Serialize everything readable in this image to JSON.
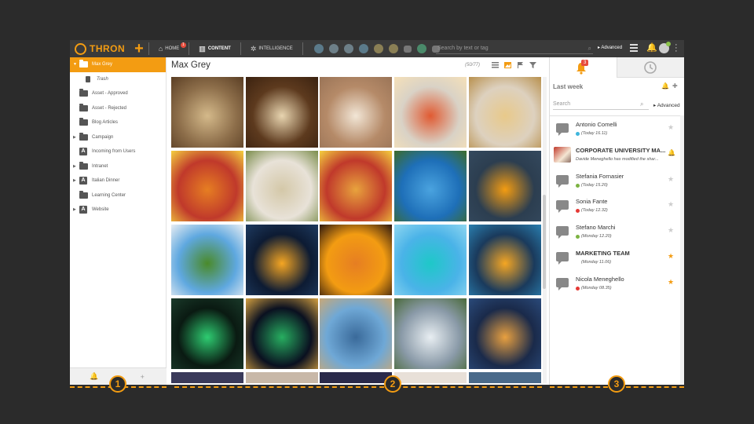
{
  "app": {
    "brand": "THRON",
    "nav": [
      {
        "label": "HOME",
        "icon": "home-icon",
        "badge": "1"
      },
      {
        "label": "CONTENT",
        "icon": "book-icon"
      },
      {
        "label": "INTELLIGENCE",
        "icon": "network-icon"
      }
    ],
    "search_placeholder": "Search by text or tag",
    "advanced_label": "Advanced",
    "accent_color": "#f39c12"
  },
  "sidebar": {
    "folders": [
      {
        "label": "Max Grey",
        "type": "folder",
        "selected": true,
        "caret": "down"
      },
      {
        "label": "Trash",
        "type": "trash",
        "indent": true
      },
      {
        "label": "Asset - Approved",
        "type": "folder"
      },
      {
        "label": "Asset - Rejected",
        "type": "folder"
      },
      {
        "label": "Blog Articles",
        "type": "folder"
      },
      {
        "label": "Campaign",
        "type": "folder",
        "caret": "right"
      },
      {
        "label": "Incoming from Users",
        "type": "shared"
      },
      {
        "label": "Intranet",
        "type": "folder",
        "caret": "right"
      },
      {
        "label": "Italian Dinner",
        "type": "shared",
        "caret": "right"
      },
      {
        "label": "Learning Center",
        "type": "folder"
      },
      {
        "label": "Website",
        "type": "shared",
        "caret": "right"
      }
    ]
  },
  "main": {
    "title": "Max Grey",
    "count": "(50/77)",
    "thumbnails": [
      {
        "subject": "mushroom risotto",
        "colors": [
          "#8d6e4a",
          "#d4b98a",
          "#5a3e24"
        ]
      },
      {
        "subject": "tiramisu",
        "colors": [
          "#5d3a1e",
          "#e8d5b0",
          "#3b2210"
        ]
      },
      {
        "subject": "dough ball",
        "colors": [
          "#b58a68",
          "#f2e6d6",
          "#9a7457"
        ]
      },
      {
        "subject": "pizza with cheese",
        "colors": [
          "#d9d2c6",
          "#e05a32",
          "#f5e0b8"
        ]
      },
      {
        "subject": "spaghetti nest",
        "colors": [
          "#ddd1bf",
          "#e8c98a",
          "#b8904d"
        ]
      },
      {
        "subject": "lasagna",
        "colors": [
          "#c0392b",
          "#e67e22",
          "#f4d03f"
        ]
      },
      {
        "subject": "risotto bowl",
        "colors": [
          "#e8e2d8",
          "#d4c8a8",
          "#7a8c4a"
        ]
      },
      {
        "subject": "penne pasta",
        "colors": [
          "#c0392b",
          "#e8a33d",
          "#f4d03f"
        ]
      },
      {
        "subject": "palm beach",
        "colors": [
          "#1e6fb8",
          "#4aa3df",
          "#3d6b2a"
        ]
      },
      {
        "subject": "rocky sea sunset",
        "colors": [
          "#2c3e50",
          "#f39c12",
          "#34495e"
        ]
      },
      {
        "subject": "alpine valley",
        "colors": [
          "#5fa8e0",
          "#4a8a2a",
          "#e8edf2"
        ]
      },
      {
        "subject": "city at night",
        "colors": [
          "#0d1b33",
          "#f5a623",
          "#1e3a5f"
        ]
      },
      {
        "subject": "jumping silhouettes",
        "colors": [
          "#f39c12",
          "#e67e22",
          "#2c1810"
        ]
      },
      {
        "subject": "overwater bungalows",
        "colors": [
          "#4ab3e8",
          "#1ec8c8",
          "#8fd6f0"
        ]
      },
      {
        "subject": "infinity pool",
        "colors": [
          "#1a3a5c",
          "#f5a623",
          "#2a7fb0"
        ]
      },
      {
        "subject": "aurora mountain",
        "colors": [
          "#0a1a12",
          "#2ecc71",
          "#1a3a2a"
        ]
      },
      {
        "subject": "aurora over harbour",
        "colors": [
          "#0a1020",
          "#27ae60",
          "#d4a040"
        ]
      },
      {
        "subject": "coastal city aerial",
        "colors": [
          "#6fa8d6",
          "#3a6a9a",
          "#c8a878"
        ]
      },
      {
        "subject": "waterfall",
        "colors": [
          "#8a9aa8",
          "#e8eef2",
          "#4a6a3a"
        ]
      },
      {
        "subject": "skyline at dusk",
        "colors": [
          "#1a2a4a",
          "#e8a040",
          "#2a4a7a"
        ]
      }
    ]
  },
  "right_panel": {
    "notifications_badge": "3",
    "section_title": "Last week",
    "search_placeholder": "Search",
    "advanced_label": "Advanced",
    "items": [
      {
        "name": "Antonio Comelli",
        "time": "(Today 16.11)",
        "dot": "#3fb6dc",
        "star": false,
        "kind": "comment"
      },
      {
        "name": "CORPORATE UNIVERSITY MA...",
        "desc": "Davide Meneghello has modified the shar...",
        "kind": "content",
        "mark": "bell"
      },
      {
        "name": "Stefania Fornasier",
        "time": "(Today 15.20)",
        "dot": "#7cb342",
        "star": false,
        "kind": "comment"
      },
      {
        "name": "Sonia Fante",
        "time": "(Today 12.32)",
        "dot": "#e53935",
        "star": false,
        "kind": "comment"
      },
      {
        "name": "Stefano Marchi",
        "time": "(Monday 12.20)",
        "dot": "#7cb342",
        "star": false,
        "kind": "comment"
      },
      {
        "name": "MARKETING TEAM",
        "time": "(Monday 11.06)",
        "dot": "",
        "star": true,
        "kind": "group"
      },
      {
        "name": "Nicola Meneghello",
        "time": "(Monday 08.35)",
        "dot": "#e53935",
        "star": true,
        "kind": "comment"
      }
    ]
  },
  "annotations": [
    "1",
    "2",
    "3"
  ]
}
